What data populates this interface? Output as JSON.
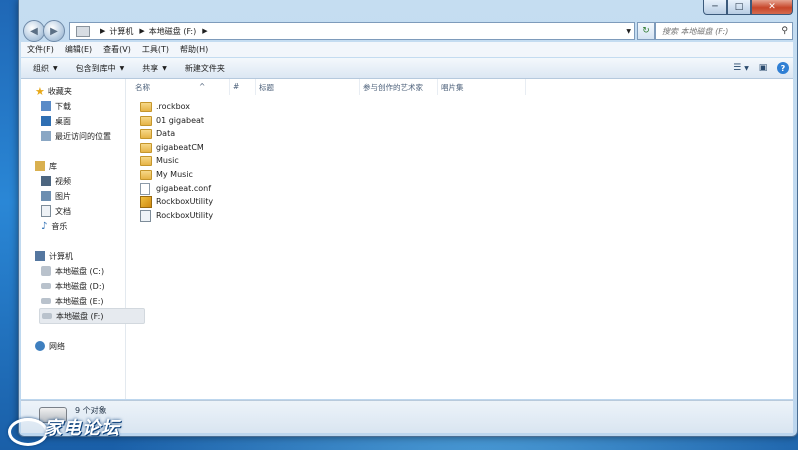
{
  "window": {
    "caption": {
      "minimize": "─",
      "maximize": "□",
      "close": "✕"
    }
  },
  "address": {
    "crumbs": [
      "计算机",
      "本地磁盘 (F:)"
    ],
    "search_placeholder": "搜索 本地磁盘 (F:)"
  },
  "menu": [
    "文件(F)",
    "编辑(E)",
    "查看(V)",
    "工具(T)",
    "帮助(H)"
  ],
  "commands": [
    {
      "label": "组织",
      "has_dropdown": true
    },
    {
      "label": "包含到库中",
      "has_dropdown": true
    },
    {
      "label": "共享",
      "has_dropdown": true
    },
    {
      "label": "新建文件夹",
      "has_dropdown": false
    }
  ],
  "nav": {
    "favorites": {
      "label": "收藏夹",
      "items": [
        "下载",
        "桌面",
        "最近访问的位置"
      ]
    },
    "libraries": {
      "label": "库",
      "items": [
        "视频",
        "图片",
        "文档",
        "音乐"
      ]
    },
    "computer": {
      "label": "计算机",
      "items": [
        "本地磁盘 (C:)",
        "本地磁盘 (D:)",
        "本地磁盘 (E:)",
        "本地磁盘 (F:)"
      ],
      "selected": "本地磁盘 (F:)"
    },
    "network": {
      "label": "网络"
    }
  },
  "columns": [
    "名称",
    "#",
    "标题",
    "参与创作的艺术家",
    "唱片集"
  ],
  "files": [
    {
      "name": ".rockbox",
      "type": "folder"
    },
    {
      "name": "01 gigabeat",
      "type": "folder"
    },
    {
      "name": "Data",
      "type": "folder"
    },
    {
      "name": "gigabeatCM",
      "type": "folder"
    },
    {
      "name": "Music",
      "type": "folder"
    },
    {
      "name": "My Music",
      "type": "folder"
    },
    {
      "name": "gigabeat.conf",
      "type": "file"
    },
    {
      "name": "RockboxUtility",
      "type": "app"
    },
    {
      "name": "RockboxUtility",
      "type": "ini"
    }
  ],
  "status": {
    "count_text": "9 个对象"
  },
  "watermark": {
    "text": "家电论坛"
  }
}
